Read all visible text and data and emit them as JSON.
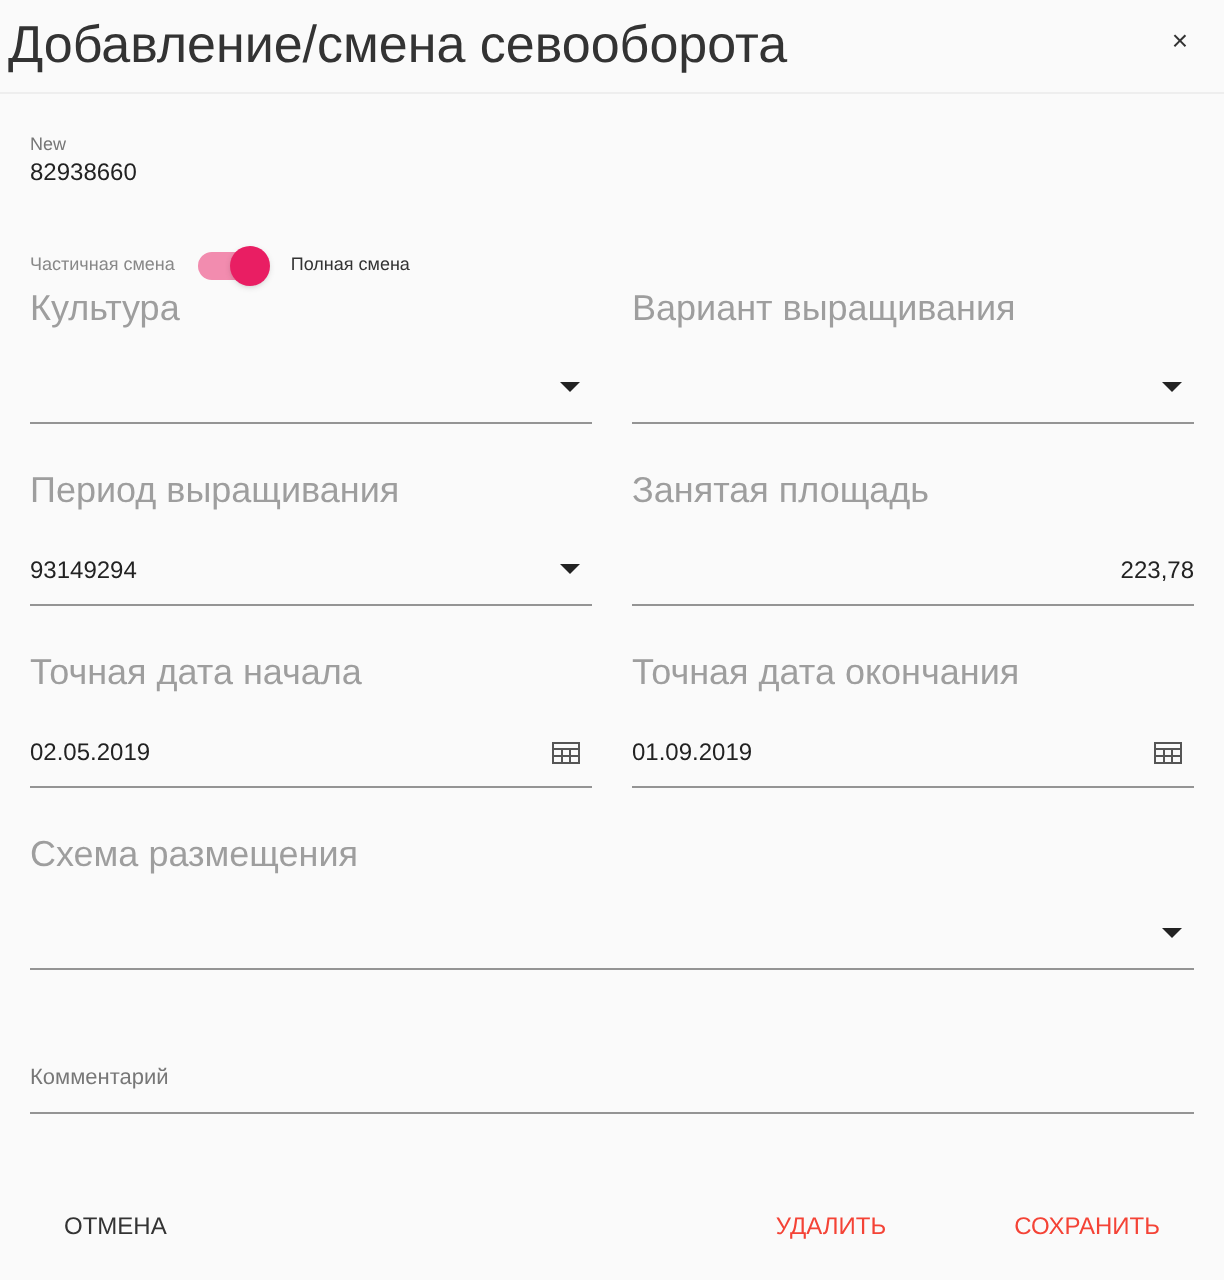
{
  "title": "Добавление/смена севооборота",
  "close": "×",
  "record": {
    "label": "New",
    "value": "82938660"
  },
  "mode_switch": {
    "off_label": "Частичная смена",
    "on_label": "Полная смена",
    "on": true
  },
  "fields": [
    {
      "kind": "select",
      "label": "Культура"
    },
    {
      "kind": "select",
      "label": "Вариант выращивания"
    },
    {
      "kind": "select",
      "label": "Период выращивания",
      "value": "93149294"
    },
    {
      "kind": "number",
      "label": "Занятая площадь",
      "value": "223,78"
    },
    {
      "kind": "date",
      "label": "Точная дата начала",
      "value": "02.05.2019"
    },
    {
      "kind": "date",
      "label": "Точная дата окончания",
      "value": "01.09.2019"
    },
    {
      "kind": "select",
      "label": "Схема размещения",
      "wide": true
    }
  ],
  "comment": {
    "placeholder": "Комментарий"
  },
  "buttons": [
    {
      "label": "ОТМЕНА",
      "kind": "neutral"
    },
    {
      "label": "УДАЛИТЬ",
      "kind": "danger"
    },
    {
      "label": "СОХРАНИТЬ",
      "kind": "danger"
    }
  ]
}
